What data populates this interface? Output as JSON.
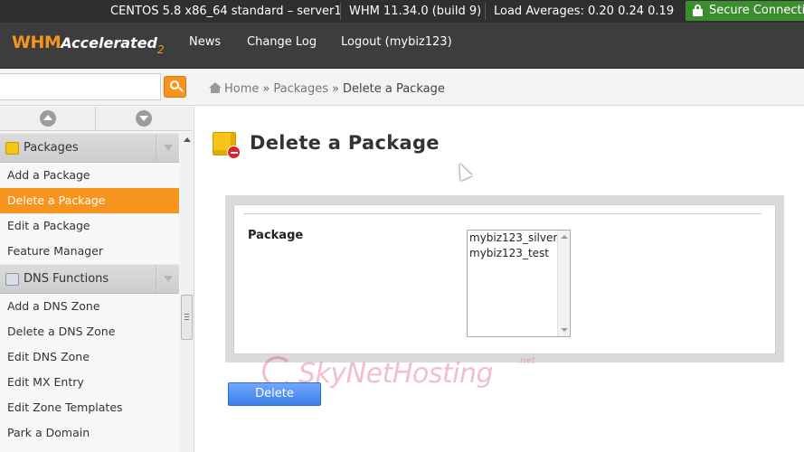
{
  "statusbar": {
    "server": "CENTOS 5.8 x86_64 standard – server1",
    "version": "WHM 11.34.0 (build 9)",
    "load": "Load Averages: 0.20 0.24 0.19",
    "secure": "Secure Connection"
  },
  "header": {
    "logo_main": "WHM",
    "logo_accel": "Accelerated",
    "logo_num": "2",
    "nav": [
      "News",
      "Change Log",
      "Logout (mybiz123)"
    ]
  },
  "search": {
    "value": "",
    "placeholder": ""
  },
  "breadcrumb": {
    "home": "Home",
    "sep": "»",
    "packages": "Packages",
    "current": "Delete a Package"
  },
  "sidebar": {
    "categories": [
      {
        "label": "Packages",
        "icon": "package-icon",
        "items": [
          "Add a Package",
          "Delete a Package",
          "Edit a Package",
          "Feature Manager"
        ],
        "active": 1
      },
      {
        "label": "DNS Functions",
        "icon": "dns-icon",
        "items": [
          "Add a DNS Zone",
          "Delete a DNS Zone",
          "Edit DNS Zone",
          "Edit MX Entry",
          "Edit Zone Templates",
          "Park a Domain"
        ]
      }
    ]
  },
  "main": {
    "title": "Delete a Package",
    "package_label": "Package",
    "packages": [
      "mybiz123_silver",
      "mybiz123_test"
    ],
    "delete_label": "Delete"
  },
  "watermark": {
    "text": "SkyNetHosting",
    "suffix": ".net"
  },
  "colors": {
    "accent": "#f7941d",
    "button": "#4a8cf0",
    "secure": "#3c8d2f"
  }
}
